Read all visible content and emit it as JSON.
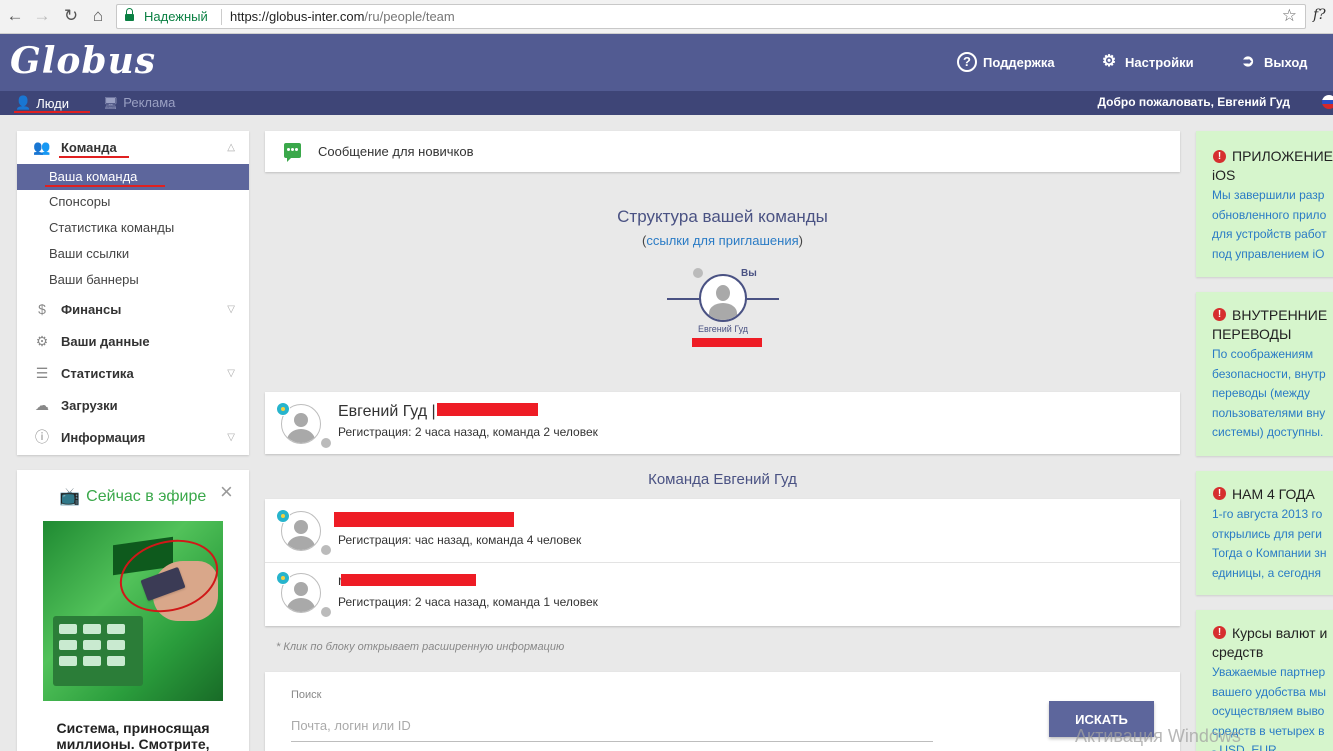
{
  "browser": {
    "secure_label": "Надежный",
    "url_host": "https://globus-inter.com",
    "url_path": "/ru/people/team",
    "ext_label": "f?"
  },
  "header": {
    "logo": "Globus",
    "support_label": "Поддержка",
    "settings_label": "Настройки",
    "logout_label": "Выход"
  },
  "subnav": {
    "people_label": "Люди",
    "ads_label": "Реклама",
    "welcome": "Добро пожаловать, Евгений Гуд"
  },
  "sidebar": {
    "team": {
      "label": "Команда"
    },
    "team_items": [
      "Ваша команда",
      "Спонсоры",
      "Статистика команды",
      "Ваши ссылки",
      "Ваши баннеры"
    ],
    "finance": {
      "label": "Финансы"
    },
    "your_data": {
      "label": "Ваши данные"
    },
    "stats": {
      "label": "Статистика"
    },
    "downloads": {
      "label": "Загрузки"
    },
    "info": {
      "label": "Информация"
    }
  },
  "live": {
    "title": "Сейчас в эфире",
    "close": "×",
    "text": "Система, приносящая миллионы. Смотрите,"
  },
  "newbie": {
    "text": "Сообщение для новичков"
  },
  "structure": {
    "title": "Структура вашей команды",
    "links_open": "(",
    "links_label": "ссылки для приглашения",
    "links_close": ")",
    "you_label": "Вы",
    "node_name": "Евгений Гуд"
  },
  "me": {
    "name": "Евгений Гуд |",
    "meta": "Регистрация: 2 часа назад, команда 2 человек"
  },
  "team_title": "Команда Евгений Гуд",
  "members": [
    {
      "meta": "Регистрация: час назад, команда 4 человек"
    },
    {
      "name_prefix": "r",
      "meta": "Регистрация: 2 часа назад, команда 1 человек"
    }
  ],
  "hint": "* Клик по блоку открывает расширенную информацию",
  "search": {
    "label": "Поиск",
    "placeholder": "Почта, логин или ID",
    "button": "ИСКАТЬ"
  },
  "news": [
    {
      "title": "ПРИЛОЖЕНИЕ\niOS",
      "body": "Мы завершили разр\nобновленного прило\nдля устройств работ\nпод управлением iO"
    },
    {
      "title": "ВНУТРЕННИЕ\nПЕРЕВОДЫ",
      "body": "По соображениям\nбезопасности, внутр\nпереводы (между\nпользователями вну\nсистемы) доступны."
    },
    {
      "title": "НАМ 4 ГОДА",
      "body": "1-го августа 2013 го\nоткрылись для реги\nТогда о Компании зн\nединицы, а сегодня"
    },
    {
      "title": "Курсы валют и\nсредств",
      "body": "Уважаемые партнер\nвашего удобства мы\nосуществляем выво\nсредств в четырех в\n- USD, EUR"
    }
  ],
  "watermark": "Активация Windows",
  "colors": {
    "header_bg": "#525b92",
    "subnav_bg": "#3e4577",
    "active_item": "#5d669c",
    "news_bg": "#d6f5cc",
    "link": "#2a7bc5",
    "accent_green": "#3aa84a",
    "redaction": "#ee1c25"
  }
}
